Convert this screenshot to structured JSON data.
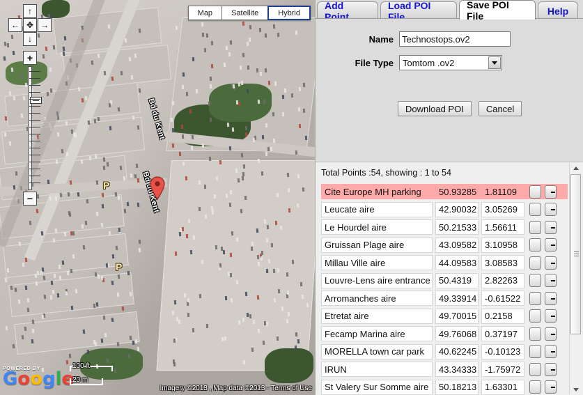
{
  "map": {
    "pan_controls": {
      "up": "↑",
      "left": "←",
      "center": "✥",
      "right": "→",
      "down": "↓"
    },
    "zoom_controls": {
      "zoom_in": "+",
      "zoom_out": "−"
    },
    "map_types": [
      {
        "label": "Map",
        "active": false
      },
      {
        "label": "Satellite",
        "active": false
      },
      {
        "label": "Hybrid",
        "active": true
      }
    ],
    "street_labels": [
      "Bd du Kent",
      "Bd du Kent"
    ],
    "parking_markers": [
      "P",
      "P"
    ],
    "logo": {
      "powered_by": "POWERED BY",
      "text": "Google"
    },
    "scale": {
      "imperial": "100 ft",
      "metric": "20 m"
    },
    "attribution": "Imagery ©2013 , Map data ©2013 - Terms of Use",
    "attribution_link": "Terms of Use"
  },
  "tabs": [
    {
      "label": "Add Point",
      "active": false
    },
    {
      "label": "Load POI File",
      "active": false
    },
    {
      "label": "Save POI File",
      "active": true
    },
    {
      "label": "Help",
      "active": false
    }
  ],
  "form": {
    "name_label": "Name",
    "name_value": "Technostops.ov2",
    "filetype_label": "File Type",
    "filetype_value": "Tomtom .ov2",
    "download_button": "Download POI",
    "cancel_button": "Cancel"
  },
  "list": {
    "totals": "Total Points :54, showing : 1 to 54",
    "points": [
      {
        "name": "Cite Europe MH parking",
        "lat": "50.93285",
        "lon": "1.81109",
        "selected": true
      },
      {
        "name": "Leucate aire",
        "lat": "42.90032",
        "lon": "3.05269",
        "selected": false
      },
      {
        "name": "Le Hourdel aire",
        "lat": "50.21533",
        "lon": "1.56611",
        "selected": false
      },
      {
        "name": "Gruissan Plage aire",
        "lat": "43.09582",
        "lon": "3.10958",
        "selected": false
      },
      {
        "name": "Millau Ville aire",
        "lat": "44.09583",
        "lon": "3.08583",
        "selected": false
      },
      {
        "name": "Louvre-Lens aire entrance",
        "lat": "50.4319",
        "lon": "2.82263",
        "selected": false
      },
      {
        "name": "Arromanches aire",
        "lat": "49.33914",
        "lon": "-0.61522",
        "selected": false
      },
      {
        "name": "Etretat aire",
        "lat": "49.70015",
        "lon": "0.2158",
        "selected": false
      },
      {
        "name": "Fecamp Marina aire",
        "lat": "49.76068",
        "lon": "0.37197",
        "selected": false
      },
      {
        "name": "MORELLA town car park",
        "lat": "40.62245",
        "lon": "-0.10123",
        "selected": false
      },
      {
        "name": "IRUN",
        "lat": "43.34333",
        "lon": "-1.75972",
        "selected": false
      },
      {
        "name": "St Valery Sur Somme aire",
        "lat": "50.18213",
        "lon": "1.63301",
        "selected": false
      }
    ]
  },
  "colors": {
    "tab_text": "#1414d6",
    "selected_row": "#ffaaaa",
    "panel_bg": "#dcdcdc",
    "list_bg": "#efefef"
  }
}
